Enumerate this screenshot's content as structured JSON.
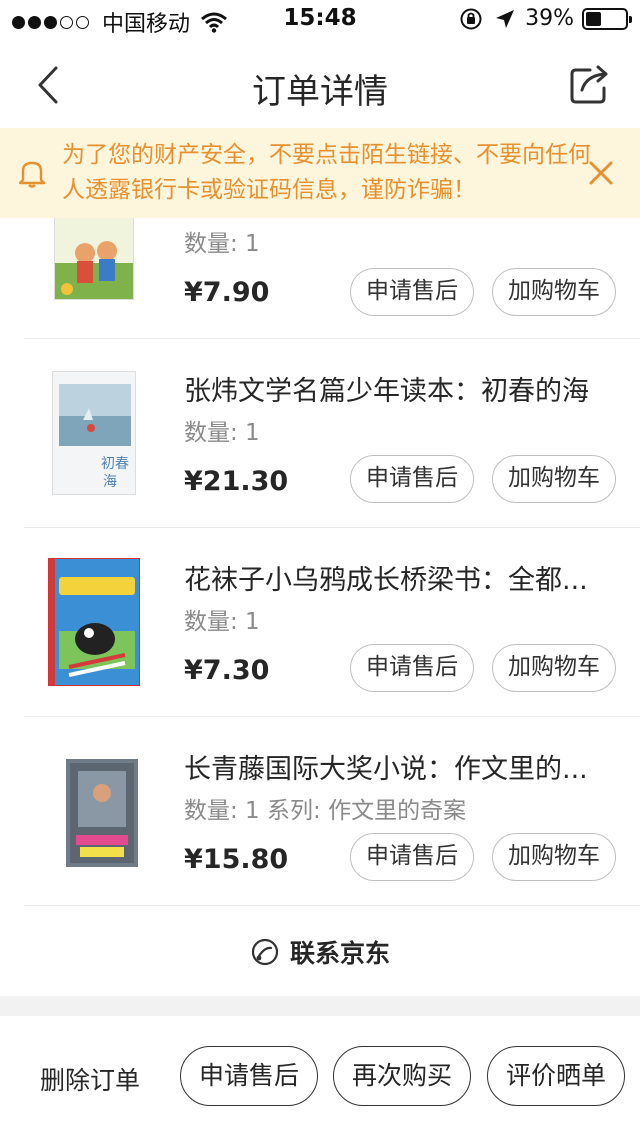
{
  "status_bar": {
    "carrier": "中国移动",
    "time": "15:48",
    "battery": "39%",
    "battery_level": 0.39
  },
  "nav": {
    "title": "订单详情"
  },
  "notice": {
    "text": "为了您的财产安全，不要点击陌生链接、不要向任何人透露银行卡或验证码信息，谨防诈骗！",
    "color": "#e8902f"
  },
  "products": [
    {
      "title": "",
      "quantity": "数量: 1",
      "price": "¥7.90",
      "after_sale_label": "申请售后",
      "add_cart_label": "加购物车"
    },
    {
      "title": "张炜文学名篇少年读本：初春的海",
      "quantity": "数量: 1",
      "price": "¥21.30",
      "after_sale_label": "申请售后",
      "add_cart_label": "加购物车"
    },
    {
      "title": "花袜子小乌鸦成长桥梁书：全都...",
      "quantity": "数量: 1",
      "price": "¥7.30",
      "after_sale_label": "申请售后",
      "add_cart_label": "加购物车"
    },
    {
      "title": "长青藤国际大奖小说：作文里的...",
      "quantity": "数量: 1 系列: 作文里的奇案",
      "price": "¥15.80",
      "after_sale_label": "申请售后",
      "add_cart_label": "加购物车"
    }
  ],
  "contact": {
    "label": "联系京东"
  },
  "bottom_bar": {
    "delete_label": "删除订单",
    "after_sale_label": "申请售后",
    "buy_again_label": "再次购买",
    "review_label": "评价晒单"
  }
}
